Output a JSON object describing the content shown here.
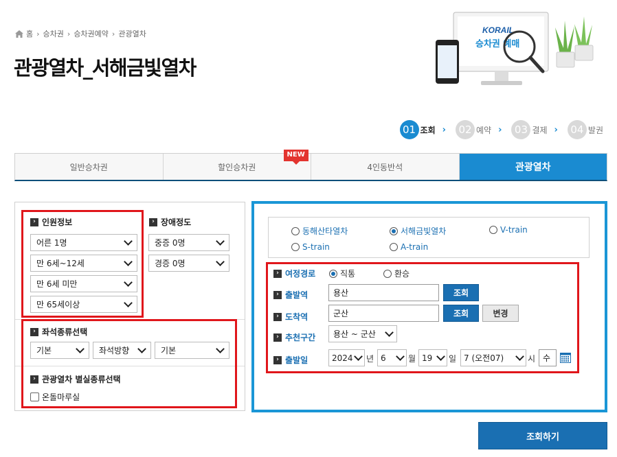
{
  "breadcrumb": {
    "items": [
      "홈",
      "승차권",
      "승차권예약",
      "관광열차"
    ]
  },
  "page_title": "관광열차_서해금빛열차",
  "hero": {
    "brand": "KORAIL",
    "caption": "승차권 예매"
  },
  "steps": [
    {
      "num": "01",
      "label": "조회",
      "active": true
    },
    {
      "num": "02",
      "label": "예약",
      "active": false
    },
    {
      "num": "03",
      "label": "결제",
      "active": false
    },
    {
      "num": "04",
      "label": "발권",
      "active": false
    }
  ],
  "tabs": [
    {
      "label": "일반승차권",
      "active": false
    },
    {
      "label": "할인승차권",
      "active": false,
      "badge": "NEW"
    },
    {
      "label": "4인동반석",
      "active": false
    },
    {
      "label": "관광열차",
      "active": true
    }
  ],
  "passenger": {
    "title": "인원정보",
    "selects": [
      "어른 1명",
      "만 6세~12세",
      "만 6세 미만",
      "만 65세이상"
    ]
  },
  "disability": {
    "title": "장애정도",
    "selects": [
      "중증 0명",
      "경증 0명"
    ]
  },
  "seat": {
    "title": "좌석종류선택",
    "selects": [
      "기본",
      "좌석방향",
      "기본"
    ]
  },
  "room": {
    "title": "관광열차 별실종류선택",
    "checkbox_label": "온돌마루실",
    "checked": false
  },
  "trains": [
    {
      "label": "동해산타열차",
      "selected": false
    },
    {
      "label": "서해금빛열차",
      "selected": true
    },
    {
      "label": "V-train",
      "selected": false
    },
    {
      "label": "S-train",
      "selected": false
    },
    {
      "label": "A-train",
      "selected": false
    }
  ],
  "route": {
    "label": "여정경로",
    "options": [
      {
        "label": "직통",
        "selected": true
      },
      {
        "label": "환승",
        "selected": false
      }
    ]
  },
  "departure": {
    "label": "출발역",
    "value": "용산",
    "button": "조회",
    "change_button": "변경"
  },
  "arrival": {
    "label": "도착역",
    "value": "군산",
    "button": "조회"
  },
  "recommend": {
    "label": "추천구간",
    "value": "용산 ~ 군산"
  },
  "date": {
    "label": "출발일",
    "year": "2024",
    "year_unit": "년",
    "month": "6",
    "month_unit": "월",
    "day": "19",
    "day_unit": "일",
    "hour": "7 (오전07)",
    "hour_unit": "시",
    "weekday": "수"
  },
  "submit_label": "조회하기",
  "colors": {
    "accent": "#1a8bd1",
    "link_blue": "#1a6fb2",
    "highlight_red": "#e0161b",
    "badge_red": "#e3342f"
  }
}
